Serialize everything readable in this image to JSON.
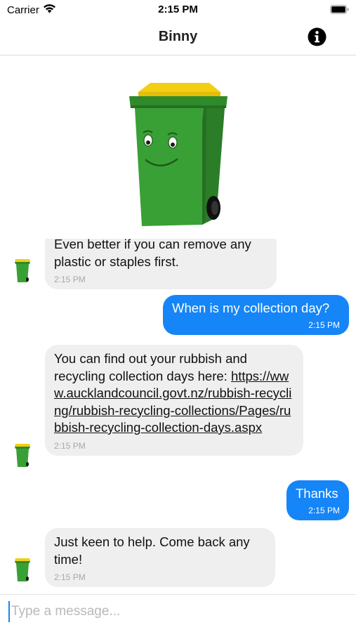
{
  "status_bar": {
    "carrier": "Carrier",
    "time": "2:15 PM"
  },
  "nav": {
    "title": "Binny",
    "info_icon": "info-circle-icon"
  },
  "messages": [
    {
      "sender": "bot",
      "text": "Even better if you can remove any plastic or staples first.",
      "time": "2:15 PM"
    },
    {
      "sender": "user",
      "text": "When is my collection day?",
      "time": "2:15 PM"
    },
    {
      "sender": "bot",
      "text_before_link": "You can find out your rubbish and recycling collection days here: ",
      "link": "https://www.aucklandcouncil.govt.nz/rubbish-recycling/rubbish-recycling-collections/Pages/rubbish-recycling-collection-days.aspx",
      "time": "2:15 PM"
    },
    {
      "sender": "user",
      "text": "Thanks",
      "time": "2:15 PM"
    },
    {
      "sender": "bot",
      "text": "Just keen to help. Come back any time!",
      "time": "2:15 PM"
    }
  ],
  "input": {
    "placeholder": "Type a message..."
  },
  "colors": {
    "accent": "#1585f7",
    "incoming_bubble": "#efefef",
    "bin_green": "#2f8a2c",
    "bin_lid": "#f2cf12"
  }
}
